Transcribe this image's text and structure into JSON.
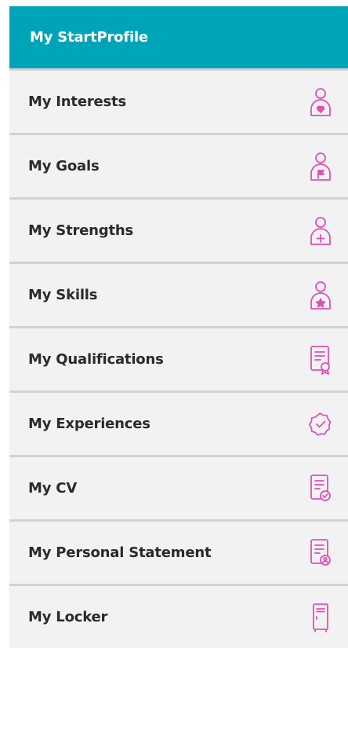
{
  "menu": {
    "header": "My StartProfile",
    "items": [
      {
        "label": "My Interests",
        "icon": "person-heart-icon"
      },
      {
        "label": "My Goals",
        "icon": "person-flag-icon"
      },
      {
        "label": "My Strengths",
        "icon": "person-plus-icon"
      },
      {
        "label": "My Skills",
        "icon": "person-star-icon"
      },
      {
        "label": "My Qualifications",
        "icon": "certificate-icon"
      },
      {
        "label": "My Experiences",
        "icon": "badge-check-icon"
      },
      {
        "label": "My CV",
        "icon": "document-check-icon"
      },
      {
        "label": "My Personal Statement",
        "icon": "document-person-icon"
      },
      {
        "label": "My Locker",
        "icon": "locker-icon"
      }
    ]
  },
  "colors": {
    "header_bg": "#00a4b9",
    "header_text": "#ffffff",
    "item_bg": "#f2f2f2",
    "divider": "#d2d2d2",
    "icon": "#e050b8"
  }
}
